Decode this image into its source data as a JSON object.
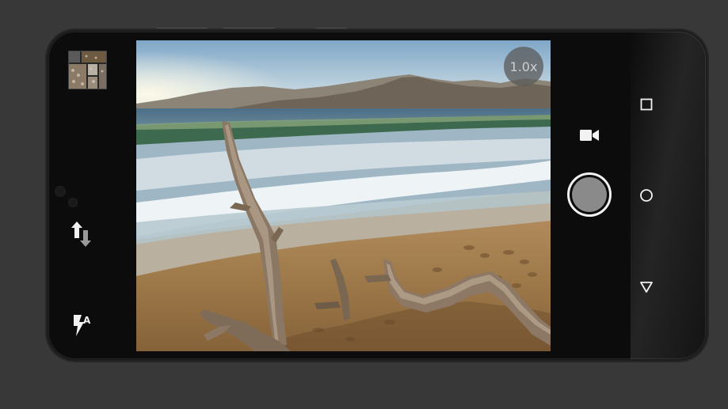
{
  "camera": {
    "zoom_label": "1.0x",
    "flash_badge": "A"
  },
  "icons": {
    "gallery": "gallery-thumbnail",
    "switch_camera": "switch-camera-icon",
    "flash_auto": "flash-auto-icon",
    "video": "video-camera-icon",
    "shutter": "shutter-button",
    "nav_recents": "square-icon",
    "nav_home": "circle-icon",
    "nav_back": "triangle-back-icon"
  },
  "colors": {
    "background": "#383838",
    "phone_body": "#0c0c0c",
    "shutter_fill": "#8a8a8a",
    "icon": "#f2f2f2"
  }
}
